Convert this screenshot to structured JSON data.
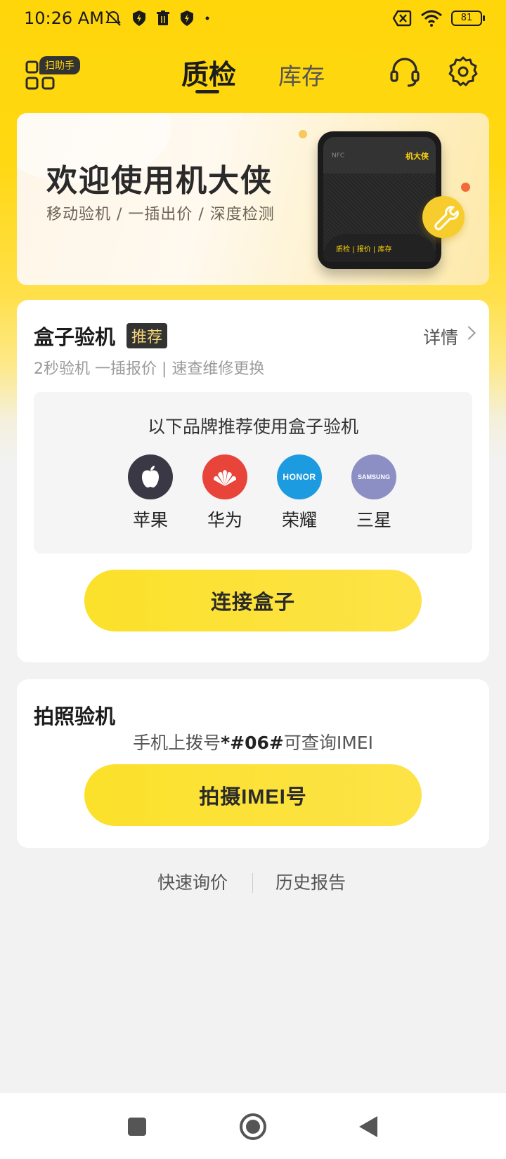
{
  "status_bar": {
    "time": "10:26 AM",
    "battery": "81",
    "icons_left": [
      "mute-alarm-icon",
      "shield-icon",
      "trash-icon",
      "shield-icon",
      "dot-icon"
    ],
    "icons_right": [
      "sim-error-icon",
      "wifi-icon",
      "battery-icon"
    ]
  },
  "header": {
    "scan_badge": "扫助手",
    "tabs": [
      {
        "label": "质检",
        "active": true
      },
      {
        "label": "库存",
        "active": false
      }
    ],
    "icons": [
      "headset-icon",
      "gear-icon"
    ]
  },
  "banner": {
    "title": "欢迎使用机大侠",
    "subtitle": "移动验机 / 一插出价 / 深度检测",
    "device_nfc": "NFC",
    "device_logo": "机大侠",
    "device_menu": "质检 | 报价 | 库存"
  },
  "box_check": {
    "title": "盒子验机",
    "badge": "推荐",
    "detail_label": "详情",
    "subtitle": "2秒验机 一插报价 | 速查维修更换",
    "brands_title": "以下品牌推荐使用盒子验机",
    "brands": [
      {
        "name": "苹果",
        "color": "#3a3845",
        "icon": "apple-icon"
      },
      {
        "name": "华为",
        "color": "#e8443a",
        "icon": "huawei-icon",
        "logo_text": ""
      },
      {
        "name": "荣耀",
        "color": "#1d9be0",
        "icon": "honor-icon",
        "logo_text": "HONOR"
      },
      {
        "name": "三星",
        "color": "#8b8fc3",
        "icon": "samsung-icon",
        "logo_text": "SAMSUNG"
      }
    ],
    "connect_button": "连接盒子"
  },
  "photo_check": {
    "title": "拍照验机",
    "hint_prefix": "手机上拨号",
    "hint_code": "*#06#",
    "hint_suffix": "可查询IMEI",
    "button": "拍摄IMEI号"
  },
  "links": {
    "quick_quote": "快速询价",
    "history": "历史报告"
  },
  "nav_bar": [
    "recent-apps-icon",
    "home-icon",
    "back-icon"
  ],
  "colors": {
    "accent_yellow": "#ffd60a",
    "button_yellow": "#fbe12a",
    "dark": "#333333"
  }
}
